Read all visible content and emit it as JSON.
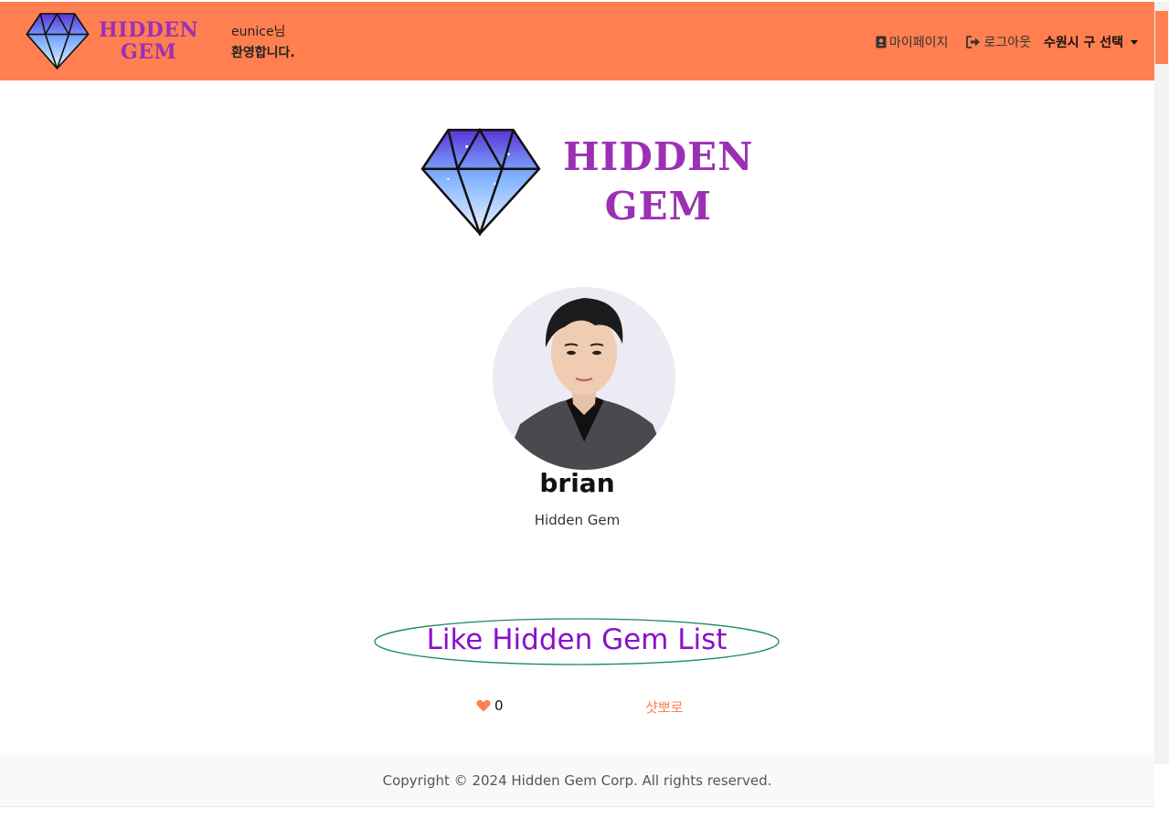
{
  "navbar": {
    "brand_line1": "HIDDEN",
    "brand_line2": "GEM",
    "welcome_line1": "eunice님",
    "welcome_line2": "환영합니다.",
    "mypage_label": "마이페이지",
    "logout_label": "로그아웃",
    "region_label": "수원시 구 선택",
    "bg_color": "#ff7f50"
  },
  "hero": {
    "line1": "HIDDEN",
    "line2": "GEM",
    "text_color": "#9b30b5"
  },
  "profile": {
    "name": "brian",
    "subtitle": "Hidden Gem"
  },
  "like_list": {
    "title": "Like Hidden Gem List",
    "title_color": "#8a10c9",
    "ellipse_color": "#1a8a5a",
    "items": [
      {
        "likes": "0",
        "place": "샷뽀로"
      }
    ]
  },
  "footer": {
    "copyright": "Copyright © 2024 Hidden Gem Corp. All rights reserved."
  }
}
